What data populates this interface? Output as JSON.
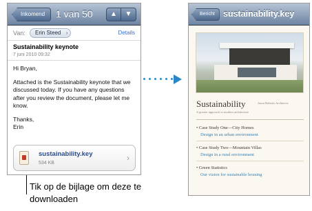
{
  "mail": {
    "back_label": "Inkomend",
    "counter": "1 van 50",
    "up_arrow": "▲",
    "down_arrow": "▼",
    "from_label": "Van:",
    "sender": "Erin Steed",
    "details_label": "Details",
    "subject": "Sustainability keynote",
    "date": "7 juni 2010 09:32",
    "greeting": "Hi Bryan,",
    "body": "Attached is the Sustainability keynote that we discussed today. If you have any questions after you review the document, please let me know.",
    "signoff": "Thanks,",
    "signature": "Erin",
    "attachment": {
      "name": "sustainability.key",
      "size": "534 KB",
      "icon": "keynote-file-icon"
    }
  },
  "preview": {
    "back_label": "Bericht",
    "title": "sustainability.key",
    "doc_title": "Sustainability",
    "doc_subtitle": "A greater approach to modern architecture",
    "doc_author": "Jason Roberts Architects",
    "cases": [
      {
        "head": "• Case Study One—City Homes",
        "desc": "Design in an urban environment"
      },
      {
        "head": "• Case Study Two—Mountain Villas",
        "desc": "Design in a rural environment"
      },
      {
        "head": "• Green Statistics",
        "desc": "Our vision for sustainable housing"
      }
    ]
  },
  "caption": "Tik op de bijlage om deze te downloaden",
  "colors": {
    "nav_bar": "#6d84a2",
    "link": "#3a6dc7",
    "arrow": "#2a86c9",
    "keynote_link": "#3b7fb0"
  }
}
